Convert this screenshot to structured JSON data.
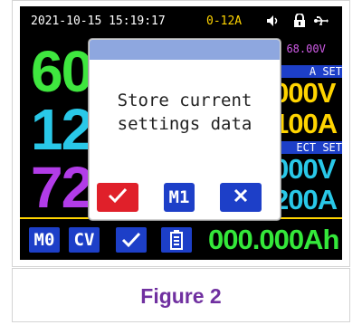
{
  "status_bar": {
    "datetime": "2021-10-15 15:19:17",
    "range": "0-12A",
    "icons": [
      "speaker-icon",
      "lock-icon",
      "usb-icon"
    ]
  },
  "main_readings": {
    "voltage": "60",
    "current": "12",
    "power": "72"
  },
  "right_panel": {
    "input_voltage": ": 68.00V",
    "set_label": "A SET",
    "set_voltage": "000V",
    "set_current": "100A",
    "protect_label": "ECT SET",
    "protect_voltage": "000V",
    "protect_current": "200A"
  },
  "bottom_bar": {
    "memory": "M0",
    "mode": "CV",
    "check_icon": "check-icon",
    "battery_icon": "battery-icon",
    "energy": "000.000Ah"
  },
  "dialog": {
    "message_line1": "Store current",
    "message_line2": "settings data",
    "confirm_icon": "check-icon",
    "slot_label": "M1",
    "cancel_icon": "close-icon"
  },
  "colors": {
    "voltage": "#3fe63f",
    "current": "#29c8e8",
    "power": "#b23ce8",
    "set": "#ffd400",
    "panel_blue": "#1d3fc8",
    "confirm": "#e0202a",
    "caption": "#7030a0"
  },
  "caption": "Figure 2"
}
